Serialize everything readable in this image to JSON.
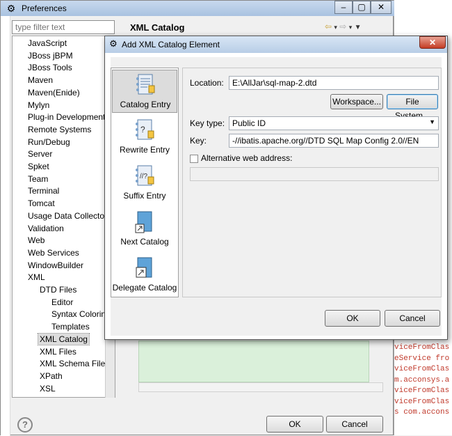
{
  "preferences": {
    "title": "Preferences",
    "filter_placeholder": "type filter text",
    "page_title": "XML Catalog",
    "tree": [
      {
        "label": "JavaScript",
        "level": 0
      },
      {
        "label": "JBoss jBPM",
        "level": 0
      },
      {
        "label": "JBoss Tools",
        "level": 0
      },
      {
        "label": "Maven",
        "level": 0
      },
      {
        "label": "Maven(Enide)",
        "level": 0
      },
      {
        "label": "Mylyn",
        "level": 0
      },
      {
        "label": "Plug-in Development",
        "level": 0
      },
      {
        "label": "Remote Systems",
        "level": 0
      },
      {
        "label": "Run/Debug",
        "level": 0
      },
      {
        "label": "Server",
        "level": 0
      },
      {
        "label": "Spket",
        "level": 0
      },
      {
        "label": "Team",
        "level": 0
      },
      {
        "label": "Terminal",
        "level": 0
      },
      {
        "label": "Tomcat",
        "level": 0
      },
      {
        "label": "Usage Data Collector",
        "level": 0
      },
      {
        "label": "Validation",
        "level": 0
      },
      {
        "label": "Web",
        "level": 0
      },
      {
        "label": "Web Services",
        "level": 0
      },
      {
        "label": "WindowBuilder",
        "level": 0
      },
      {
        "label": "XML",
        "level": 0
      },
      {
        "label": "DTD Files",
        "level": 1
      },
      {
        "label": "Editor",
        "level": 2
      },
      {
        "label": "Syntax Coloring",
        "level": 2
      },
      {
        "label": "Templates",
        "level": 2
      },
      {
        "label": "XML Catalog",
        "level": 1,
        "selected": true
      },
      {
        "label": "XML Files",
        "level": 1
      },
      {
        "label": "XML Schema Files",
        "level": 1
      },
      {
        "label": "XPath",
        "level": 1
      },
      {
        "label": "XSL",
        "level": 1
      }
    ],
    "ok_label": "OK",
    "cancel_label": "Cancel"
  },
  "background_code": [
    "viceFromClas",
    "eService fro",
    "viceFromClas",
    "m.acconsys.a",
    "viceFromClas",
    "viceFromClas",
    "s com.accons"
  ],
  "dialog": {
    "title": "Add XML Catalog Element",
    "sidebar": [
      {
        "label": "Catalog Entry",
        "icon": "catalog-entry-icon",
        "active": true
      },
      {
        "label": "Rewrite Entry",
        "icon": "rewrite-entry-icon",
        "active": false
      },
      {
        "label": "Suffix Entry",
        "icon": "suffix-entry-icon",
        "active": false
      },
      {
        "label": "Next Catalog",
        "icon": "next-catalog-icon",
        "active": false
      },
      {
        "label": "Delegate Catalog",
        "icon": "delegate-catalog-icon",
        "active": false
      }
    ],
    "location_label": "Location:",
    "location_value": "E:\\AllJar\\sql-map-2.dtd",
    "workspace_label": "Workspace...",
    "filesystem_label": "File System...",
    "key_type_label": "Key type:",
    "key_type_value": "Public ID",
    "key_label": "Key:",
    "key_value": "-//ibatis.apache.org//DTD SQL Map Config 2.0//EN",
    "alt_web_label": "Alternative web address:",
    "alt_web_checked": false,
    "ok_label": "OK",
    "cancel_label": "Cancel"
  }
}
